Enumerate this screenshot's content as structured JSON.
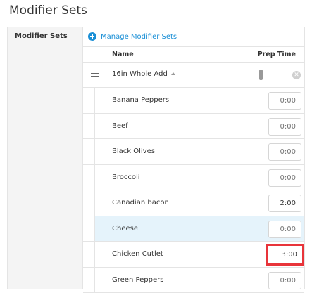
{
  "page": {
    "title": "Modifier Sets"
  },
  "panel": {
    "label": "Modifier Sets",
    "manage_link": "Manage Modifier Sets"
  },
  "table": {
    "headers": {
      "name": "Name",
      "prep_time": "Prep Time"
    },
    "group": {
      "name": "16in Whole Add",
      "remove_glyph": "✕"
    },
    "rows": [
      {
        "name": "Banana Peppers",
        "prep_time": "0:00",
        "state": "placeholder"
      },
      {
        "name": "Beef",
        "prep_time": "0:00",
        "state": "placeholder"
      },
      {
        "name": "Black Olives",
        "prep_time": "0:00",
        "state": "placeholder"
      },
      {
        "name": "Broccoli",
        "prep_time": "0:00",
        "state": "placeholder"
      },
      {
        "name": "Canadian bacon",
        "prep_time": "2:00",
        "state": "filled"
      },
      {
        "name": "Cheese",
        "prep_time": "0:00",
        "state": "placeholder",
        "selected": true
      },
      {
        "name": "Chicken Cutlet",
        "prep_time": "3:00",
        "state": "highlighted"
      },
      {
        "name": "Green Peppers",
        "prep_time": "0:00",
        "state": "placeholder"
      }
    ]
  },
  "colors": {
    "link": "#1a8fd6",
    "selected_row": "#e5f3fb",
    "highlight_border": "#e8343a"
  }
}
